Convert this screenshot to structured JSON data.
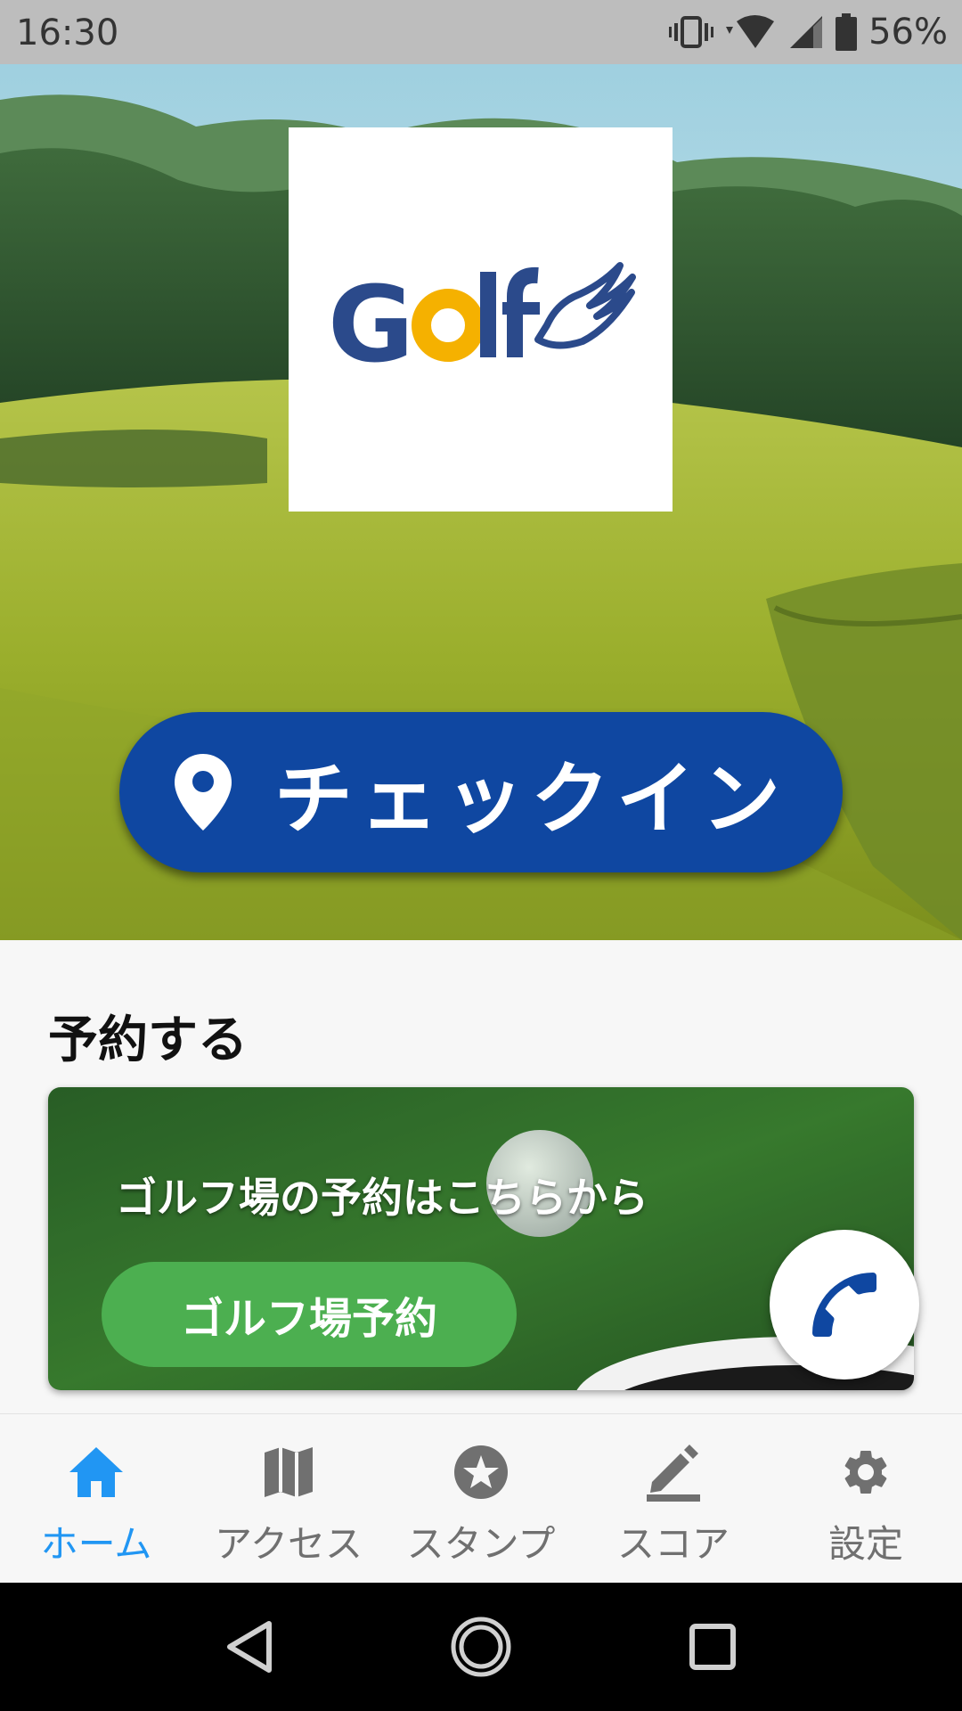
{
  "status_bar": {
    "time": "16:30",
    "battery": "56%"
  },
  "hero": {
    "logo_text": "Golf",
    "checkin_label": "チェックイン"
  },
  "reserve": {
    "section_title": "予約する",
    "card_text": "ゴルフ場の予約はこちらから",
    "button_label": "ゴルフ場予約"
  },
  "bottom_nav": {
    "items": [
      {
        "label": "ホーム",
        "icon": "home-icon",
        "active": true
      },
      {
        "label": "アクセス",
        "icon": "map-icon",
        "active": false
      },
      {
        "label": "スタンプ",
        "icon": "star-icon",
        "active": false
      },
      {
        "label": "スコア",
        "icon": "pencil-icon",
        "active": false
      },
      {
        "label": "設定",
        "icon": "gear-icon",
        "active": false
      }
    ]
  },
  "colors": {
    "checkin_blue": "#0f47a1",
    "reserve_green": "#4caf50",
    "nav_active": "#2196f3",
    "nav_inactive": "#707070",
    "logo_navy": "#2b4a8b",
    "logo_yellow": "#f5b100"
  }
}
